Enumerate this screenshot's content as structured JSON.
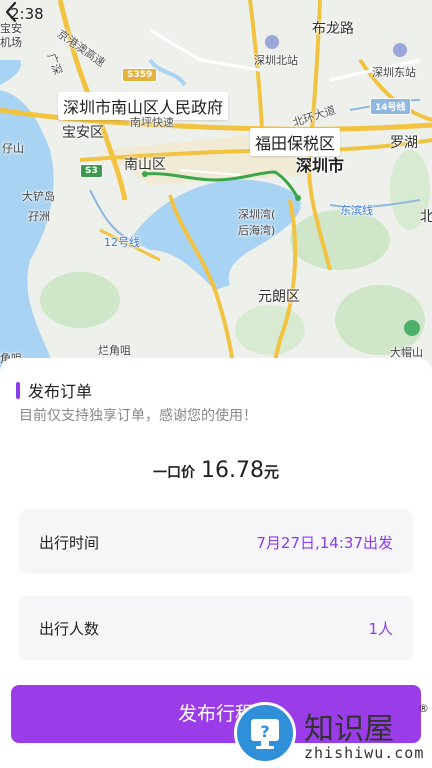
{
  "status_bar": {
    "time": "2:38"
  },
  "map": {
    "callout_origin": "深圳市南山区人民政府",
    "callout_destination": "福田保税区",
    "labels": {
      "baoan_airport_1": "宝安",
      "baoan_airport_2": "机场",
      "guangshen": "广深",
      "jinggang": "京港澳高速",
      "buji": "布龙路",
      "shenzhen_north": "深圳北站",
      "shenzhen_east": "深圳东站",
      "nanping": "南坪快速",
      "beihuan": "北环大道",
      "baoan_district": "宝安区",
      "nanshan_district": "南山区",
      "shenzhen_city": "深圳市",
      "luohu": "罗湖",
      "dachan": "大铲岛",
      "zizhou": "孖洲",
      "shenzhen_bay": "深圳湾(",
      "houhai_bay": "后海湾)",
      "yuenlong": "元朗区",
      "dongbin": "东滨线",
      "line12": "12号线",
      "line14": "14号线",
      "xinzai": "仔山",
      "lanjiaozui": "烂角咀",
      "jiaozui": "角咀",
      "damaoshan": "大帽山",
      "bei": "北",
      "s359": "S359",
      "s3": "S3"
    }
  },
  "sheet": {
    "title": "发布订单",
    "subtitle": "目前仅支持独享订单，感谢您的使用！",
    "price_label": "一口价",
    "price_value": "16.78",
    "price_unit": "元",
    "time_label": "出行时间",
    "time_value": "7月27日,14:37出发",
    "people_label": "出行人数",
    "people_value": "1人",
    "publish_label": "发布行程"
  },
  "watermark": {
    "brand": "知识屋",
    "url": "zhishiwu.com",
    "reg": "®"
  },
  "colors": {
    "accent": "#8c3cf0",
    "button": "#9a3de8",
    "route": "#3aa64a"
  }
}
